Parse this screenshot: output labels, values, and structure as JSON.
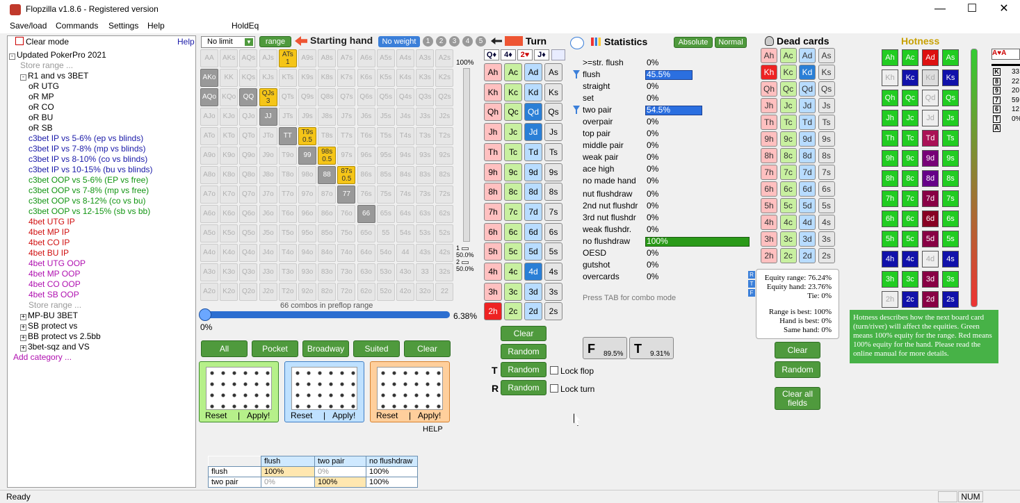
{
  "window": {
    "title": "Flopzilla v1.8.6 - Registered version",
    "minimize": "—",
    "maximize": "☐",
    "close": "✕"
  },
  "menu": {
    "items": [
      "Save/load",
      "Commands",
      "Settings",
      "Help",
      "HoldEq"
    ]
  },
  "left": {
    "clear_mode": "Clear mode",
    "help": "Help",
    "root": "Updated PokerPro 2021",
    "store_range": "Store range ...",
    "r1": "R1 and vs 3BET",
    "items": [
      {
        "t": "oR UTG",
        "c": "#000000"
      },
      {
        "t": "oR MP",
        "c": "#000000"
      },
      {
        "t": "oR CO",
        "c": "#000000"
      },
      {
        "t": "oR BU",
        "c": "#000000"
      },
      {
        "t": "oR SB",
        "c": "#000000"
      },
      {
        "t": "c3bet IP vs 5-6% (ep vs blinds)",
        "c": "#1a1aa8"
      },
      {
        "t": "c3bet IP vs 7-8% (mp vs blinds)",
        "c": "#1a1aa8"
      },
      {
        "t": "c3bet IP vs 8-10% (co vs blinds)",
        "c": "#1a1aa8"
      },
      {
        "t": "c3bet IP vs 10-15% (bu vs blinds)",
        "c": "#1a1aa8"
      },
      {
        "t": "c3bet OOP vs 5-6% (EP vs free)",
        "c": "#129512"
      },
      {
        "t": "c3bet OOP vs 7-8% (mp vs free)",
        "c": "#129512"
      },
      {
        "t": "c3bet OOP vs 8-12% (co vs bu)",
        "c": "#129512"
      },
      {
        "t": "c3bet OOP vs 12-15% (sb vs bb)",
        "c": "#129512"
      },
      {
        "t": "4bet UTG IP",
        "c": "#d01010"
      },
      {
        "t": "4bet MP IP",
        "c": "#d01010"
      },
      {
        "t": "4bet CO IP",
        "c": "#d01010"
      },
      {
        "t": "4bet BU IP",
        "c": "#d01010"
      },
      {
        "t": "4bet UTG OOP",
        "c": "#b010b0"
      },
      {
        "t": "4bet MP OOP",
        "c": "#b010b0"
      },
      {
        "t": "4bet CO OOP",
        "c": "#b010b0"
      },
      {
        "t": "4bet SB OOP",
        "c": "#b010b0"
      }
    ],
    "store_range2": "Store range ...",
    "groups": [
      "MP-BU 3BET",
      "SB protect vs",
      "BB protect vs 2.5bb",
      "3bet-sqz and VS"
    ],
    "add_category": "Add category ..."
  },
  "range": {
    "limit": "No limit",
    "range_btn": "range",
    "header": "Starting hand",
    "no_weight": "No weight",
    "nums": [
      "1",
      "2",
      "3",
      "4",
      "5"
    ],
    "grid": [
      [
        "AA",
        "AKs",
        "AQs",
        "AJs",
        "ATs",
        "A9s",
        "A8s",
        "A7s",
        "A6s",
        "A5s",
        "A4s",
        "A3s",
        "A2s"
      ],
      [
        "AKo",
        "KK",
        "KQs",
        "KJs",
        "KTs",
        "K9s",
        "K8s",
        "K7s",
        "K6s",
        "K5s",
        "K4s",
        "K3s",
        "K2s"
      ],
      [
        "AQo",
        "KQo",
        "QQ",
        "QJs",
        "QTs",
        "Q9s",
        "Q8s",
        "Q7s",
        "Q6s",
        "Q5s",
        "Q4s",
        "Q3s",
        "Q2s"
      ],
      [
        "AJo",
        "KJo",
        "QJo",
        "JJ",
        "JTs",
        "J9s",
        "J8s",
        "J7s",
        "J6s",
        "J5s",
        "J4s",
        "J3s",
        "J2s"
      ],
      [
        "ATo",
        "KTo",
        "QTo",
        "JTo",
        "TT",
        "T9s",
        "T8s",
        "T7s",
        "T6s",
        "T5s",
        "T4s",
        "T3s",
        "T2s"
      ],
      [
        "A9o",
        "K9o",
        "Q9o",
        "J9o",
        "T9o",
        "99",
        "98s",
        "97s",
        "96s",
        "95s",
        "94s",
        "93s",
        "92s"
      ],
      [
        "A8o",
        "K8o",
        "Q8o",
        "J8o",
        "T8o",
        "98o",
        "88",
        "87s",
        "86s",
        "85s",
        "84s",
        "83s",
        "82s"
      ],
      [
        "A7o",
        "K7o",
        "Q7o",
        "J7o",
        "T7o",
        "97o",
        "87o",
        "77",
        "76s",
        "75s",
        "74s",
        "73s",
        "72s"
      ],
      [
        "A6o",
        "K6o",
        "Q6o",
        "J6o",
        "T6o",
        "96o",
        "86o",
        "76o",
        "66",
        "65s",
        "64s",
        "63s",
        "62s"
      ],
      [
        "A5o",
        "K5o",
        "Q5o",
        "J5o",
        "T5o",
        "95o",
        "85o",
        "75o",
        "65o",
        "55",
        "54s",
        "53s",
        "52s"
      ],
      [
        "A4o",
        "K4o",
        "Q4o",
        "J4o",
        "T4o",
        "94o",
        "84o",
        "74o",
        "64o",
        "54o",
        "44",
        "43s",
        "42s"
      ],
      [
        "A3o",
        "K3o",
        "Q3o",
        "J3o",
        "T3o",
        "93o",
        "83o",
        "73o",
        "63o",
        "53o",
        "43o",
        "33",
        "32s"
      ],
      [
        "A2o",
        "K2o",
        "Q2o",
        "J2o",
        "T2o",
        "92o",
        "82o",
        "72o",
        "62o",
        "52o",
        "42o",
        "32o",
        "22"
      ]
    ],
    "gold_sub": {
      "ATs": "1",
      "QJs": "3",
      "T9s": "0.5",
      "98s": "0.5",
      "87s": "0.5"
    },
    "combos": "66 combos in preflop range",
    "pct": "6.38%",
    "zero": "0%",
    "hundred": "100%",
    "s1": "50.0%",
    "s2": "50.0%",
    "buttons": [
      "All",
      "Pocket",
      "Broadway",
      "Suited",
      "Clear"
    ],
    "reset": "Reset",
    "sep": "|",
    "apply": "Apply!",
    "help": "HELP"
  },
  "board": {
    "header": "Turn",
    "cards": [
      "Q♦",
      "4♦",
      "2♥",
      "J♦"
    ],
    "ranks": [
      "A",
      "K",
      "Q",
      "J",
      "T",
      "9",
      "8",
      "7",
      "6",
      "5",
      "4",
      "3",
      "2"
    ],
    "suits": [
      "h",
      "c",
      "d",
      "s"
    ],
    "clear": "Clear",
    "random": "Random",
    "lockflop": "Lock flop",
    "lockturn": "Lock turn",
    "T": "T",
    "R": "R"
  },
  "stats": {
    "header": "Statistics",
    "absolute": "Absolute",
    "normal": "Normal",
    "rows": [
      {
        "l": ">=str. flush",
        "v": "0%",
        "f": false,
        "b": 0
      },
      {
        "l": "flush",
        "v": "45.5%",
        "f": true,
        "b": 0.455
      },
      {
        "l": "straight",
        "v": "0%",
        "f": false,
        "b": 0
      },
      {
        "l": "set",
        "v": "0%",
        "f": false,
        "b": 0
      },
      {
        "l": "two pair",
        "v": "54.5%",
        "f": true,
        "b": 0.545
      },
      {
        "l": "overpair",
        "v": "0%",
        "f": false,
        "b": 0
      },
      {
        "l": "top pair",
        "v": "0%",
        "f": false,
        "b": 0
      },
      {
        "l": "middle pair",
        "v": "0%",
        "f": false,
        "b": 0
      },
      {
        "l": "weak pair",
        "v": "0%",
        "f": false,
        "b": 0
      },
      {
        "l": "ace high",
        "v": "0%",
        "f": false,
        "b": 0
      },
      {
        "l": "no made hand",
        "v": "0%",
        "f": false,
        "b": 0
      }
    ],
    "rows2": [
      {
        "l": "nut flushdraw",
        "v": "0%",
        "b": 0
      },
      {
        "l": "2nd nut flushdr",
        "v": "0%",
        "b": 0
      },
      {
        "l": "3rd nut flushdr",
        "v": "0%",
        "b": 0
      },
      {
        "l": "weak flushdr.",
        "v": "0%",
        "b": 0
      },
      {
        "l": "no flushdraw",
        "v": "100%",
        "b": 1
      },
      {
        "l": "OESD",
        "v": "0%",
        "b": 0
      },
      {
        "l": "gutshot",
        "v": "0%",
        "b": 0
      },
      {
        "l": "overcards",
        "v": "0%",
        "b": 0
      }
    ],
    "tab_hint": "Press TAB for combo mode",
    "f_val": "89.5%",
    "t_val": "9.31%",
    "f": "F",
    "t": "T",
    "flags": [
      "R",
      "T",
      "F"
    ]
  },
  "dead": {
    "header": "Dead cards",
    "equity": [
      "Equity range: 76.24%",
      "Equity hand: 23.76%",
      "Tie: 0%",
      "Range is best: 100%",
      "Hand is best: 0%",
      "Same hand: 0%"
    ],
    "clear": "Clear",
    "random": "Random",
    "clear_all": "Clear all fields"
  },
  "hot": {
    "header": "Hotness",
    "desc": "Hotness describes how the next board card (turn/river) will affect the equities. Green means 100% equity for the range. Red means 100% equity for the hand. Please read the online manual for more details."
  },
  "mini": {
    "head": "A♥A",
    "rows": [
      "K",
      "8",
      "9",
      "7",
      "6",
      "T",
      "A"
    ],
    "vals": [
      "33",
      "22",
      "20",
      "59",
      "12",
      "0%",
      ""
    ]
  },
  "table": {
    "headers": [
      "",
      "flush",
      "two pair",
      "no flushdraw"
    ],
    "rows": [
      [
        "flush",
        "100%",
        "0%",
        "100%"
      ],
      [
        "two pair",
        "0%",
        "100%",
        "100%"
      ]
    ]
  },
  "status": {
    "ready": "Ready",
    "num": "NUM"
  }
}
